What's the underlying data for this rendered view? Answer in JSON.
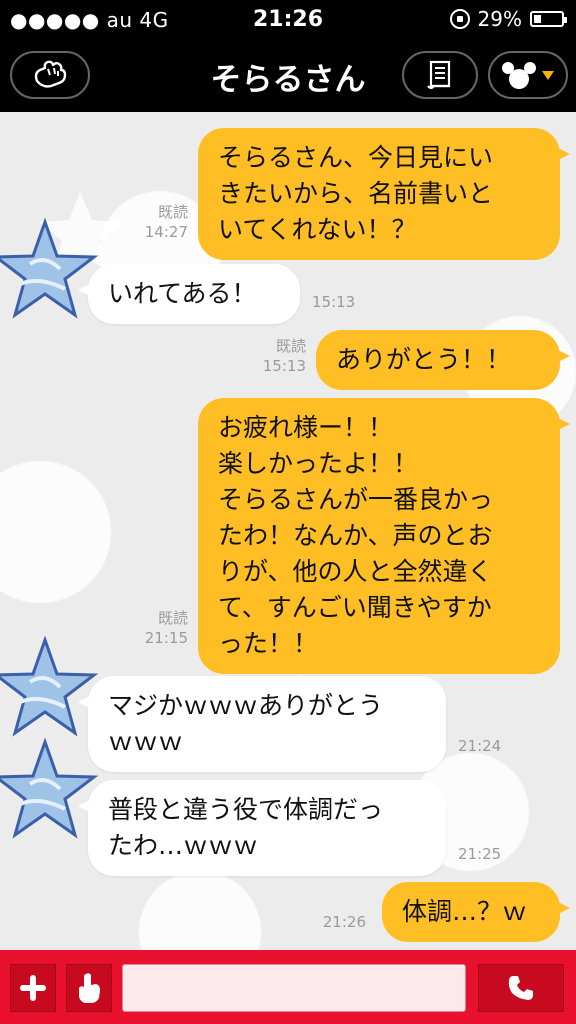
{
  "status_bar": {
    "carrier": "●●●●● au  4G",
    "time": "21:26",
    "battery": "29%"
  },
  "header": {
    "title": "そらるさん"
  },
  "messages": [
    {
      "id": 1,
      "side": "out",
      "text": "そらるさん、今日見にい\nきたいから、名前書いと\nいてくれない！？",
      "read": "既読",
      "time": "14:27"
    },
    {
      "id": 2,
      "side": "in",
      "text": "いれてある！",
      "time": "15:13"
    },
    {
      "id": 3,
      "side": "out",
      "text": "ありがとう！！",
      "read": "既読",
      "time": "15:13"
    },
    {
      "id": 4,
      "side": "out",
      "text": "お疲れ様ー！！\n楽しかったよ！！\nそらるさんが一番良かっ\nたわ！なんか、声のとお\nりが、他の人と全然違く\nて、すんごい聞きやすか\nった！！",
      "read": "既読",
      "time": "21:15"
    },
    {
      "id": 5,
      "side": "in",
      "text": "マジかｗｗｗありがとう\nｗｗｗ",
      "time": "21:24"
    },
    {
      "id": 6,
      "side": "in",
      "text": "普段と違う役で体調だっ\nたわ…ｗｗｗ",
      "time": "21:25"
    },
    {
      "id": 7,
      "side": "out",
      "text": "体調…？ｗ",
      "time": "21:26"
    }
  ],
  "colors": {
    "outgoing_bubble": "#ffbe23",
    "incoming_bubble": "#ffffff",
    "input_bar": "#e8102c"
  },
  "icons": {
    "header_left": "glove-hand-icon",
    "header_note": "scroll-note-icon",
    "header_menu": "mouse-ears-icon",
    "input_plus": "plus-icon",
    "input_sticker": "glove-hand-icon",
    "input_call": "phone-icon",
    "avatar": "blue-star-avatar-icon"
  }
}
